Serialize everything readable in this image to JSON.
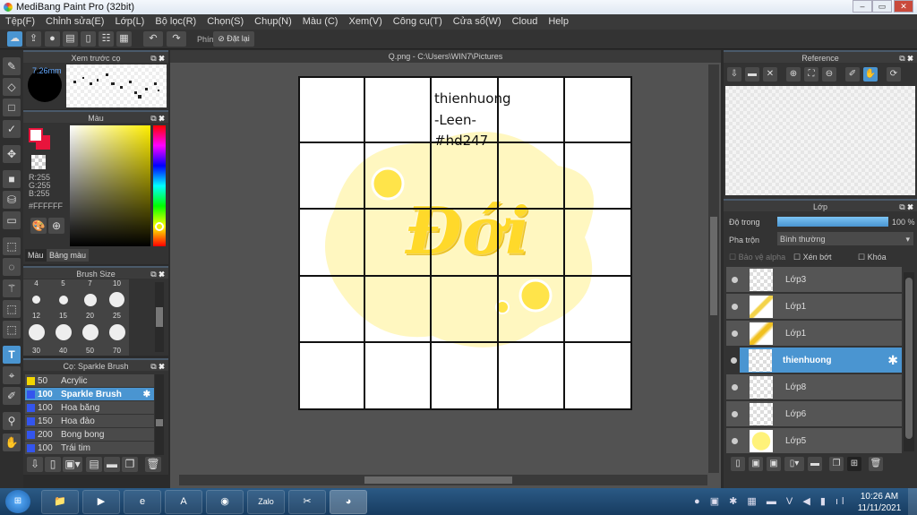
{
  "window": {
    "title": "MediBang Paint Pro (32bit)",
    "minimize": "–",
    "maximize": "▭",
    "close": "✕"
  },
  "menu": [
    "Tệp(F)",
    "Chỉnh sửa(E)",
    "Lớp(L)",
    "Bộ lọc(R)",
    "Chọn(S)",
    "Chụp(N)",
    "Màu (C)",
    "Xem(V)",
    "Công cụ(T)",
    "Cửa sổ(W)",
    "Cloud",
    "Help"
  ],
  "toolbar": {
    "shortcut_label": "Phím",
    "reset_label": "Đặt lại"
  },
  "brush_preview": {
    "title": "Xem trước cọ",
    "size": "7.26mm"
  },
  "color_panel": {
    "title": "Màu",
    "r": "R:255",
    "g": "G:255",
    "b": "B:255",
    "hex": "#FFFFFF",
    "tabs": [
      "Màu",
      "Bảng màu"
    ]
  },
  "brush_size": {
    "title": "Brush Size",
    "sizes": [
      "4",
      "5",
      "7",
      "10",
      "12",
      "15",
      "20",
      "25",
      "30",
      "40",
      "50",
      "70"
    ]
  },
  "brush_list": {
    "title": "Cọ: Sparkle Brush",
    "items": [
      {
        "size": "50",
        "name": "Acrylic",
        "color": "#f2d600"
      },
      {
        "size": "100",
        "name": "Sparkle Brush",
        "color": "#3355ee",
        "selected": true
      },
      {
        "size": "100",
        "name": "Hoa băng",
        "color": "#3355ee"
      },
      {
        "size": "150",
        "name": "Hoa đào",
        "color": "#3355ee"
      },
      {
        "size": "200",
        "name": "Bong bong",
        "color": "#3355ee"
      },
      {
        "size": "100",
        "name": "Trái tim",
        "color": "#3355ee"
      }
    ]
  },
  "document": {
    "tab": "Q.png - C:\\Users\\WIN7\\Pictures",
    "text_lines": [
      "thienhuong",
      "-Leen-",
      "#hd247"
    ],
    "art_text": "Đới"
  },
  "reference": {
    "title": "Reference"
  },
  "layers": {
    "title": "Lớp",
    "opacity_label": "Độ trong",
    "opacity_value": "100 %",
    "opacity": 1.0,
    "blend_label": "Pha trộn",
    "blend_value": "Bình thường",
    "protect_alpha": "Bảo vệ alpha",
    "clipping": "Xén bớt",
    "lock": "Khóa",
    "items": [
      {
        "name": "Lớp3"
      },
      {
        "name": "Lớp1"
      },
      {
        "name": "Lớp1"
      },
      {
        "name": "thienhuong",
        "selected": true
      },
      {
        "name": "Lớp8"
      },
      {
        "name": "Lớp6"
      },
      {
        "name": "Lớp5"
      }
    ]
  },
  "taskbar": {
    "time": "10:26 AM",
    "date": "11/11/2021",
    "apps": [
      "Explorer",
      "Media Player",
      "Internet Explorer",
      "PDF",
      "Chrome",
      "Zalo",
      "Snipping",
      "MediBang"
    ]
  },
  "colors": {
    "accent": "#4a95d1",
    "panel": "#333333",
    "canvas_bg": "#525252"
  }
}
